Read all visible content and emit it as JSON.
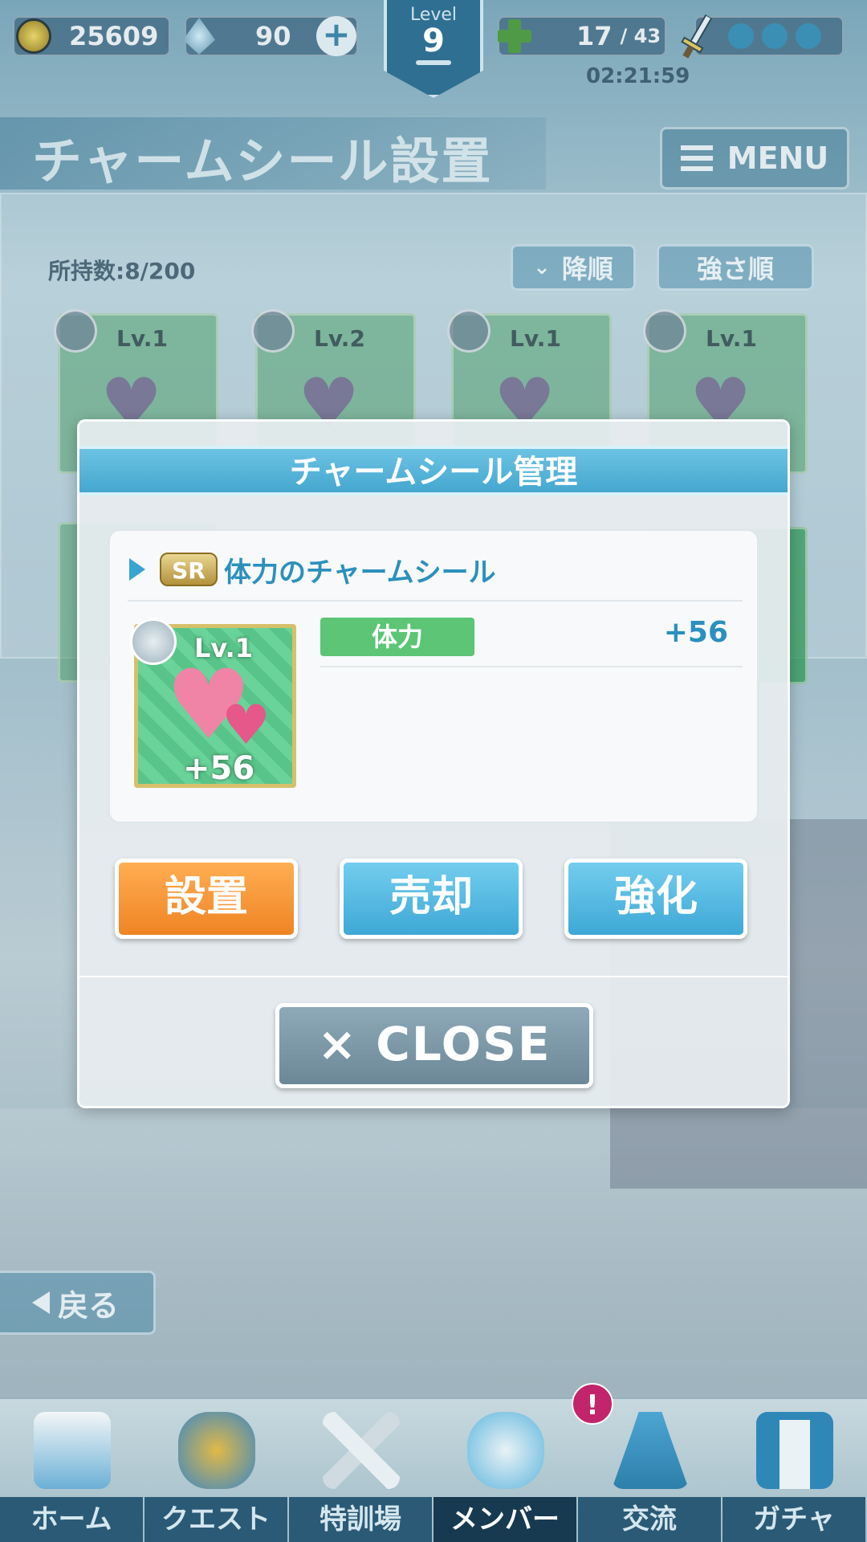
{
  "hud": {
    "coins": "25609",
    "gems": "90",
    "level_label": "Level",
    "level": "9",
    "stamina": "17",
    "stamina_max": "/ 43",
    "timer": "02:21:59"
  },
  "header": {
    "title": "チャームシール設置",
    "menu_label": "MENU"
  },
  "list": {
    "owned": "所持数:8/200",
    "sort_order": "降順",
    "sort_key": "強さ順",
    "cards": [
      {
        "level": "Lv.1"
      },
      {
        "level": "Lv.2"
      },
      {
        "level": "Lv.1"
      },
      {
        "level": "Lv.1"
      }
    ]
  },
  "modal": {
    "title": "チャームシール管理",
    "rarity": "SR",
    "item_name": "体力のチャームシール",
    "card_level": "Lv.1",
    "card_bonus": "+56",
    "stat_label": "体力",
    "stat_value": "+56",
    "buttons": {
      "place": "設置",
      "sell": "売却",
      "upgrade": "強化"
    },
    "close_label": "× CLOSE"
  },
  "back_label": "戻る",
  "nav": [
    {
      "label": "ホーム",
      "icon": "school-icon"
    },
    {
      "label": "クエスト",
      "icon": "monster-icon"
    },
    {
      "label": "特訓場",
      "icon": "crossed-swords-icon"
    },
    {
      "label": "メンバー",
      "icon": "cat-girl-icon"
    },
    {
      "label": "交流",
      "icon": "dress-icon"
    },
    {
      "label": "ガチャ",
      "icon": "curtain-icon"
    }
  ],
  "notification_mark": "!"
}
